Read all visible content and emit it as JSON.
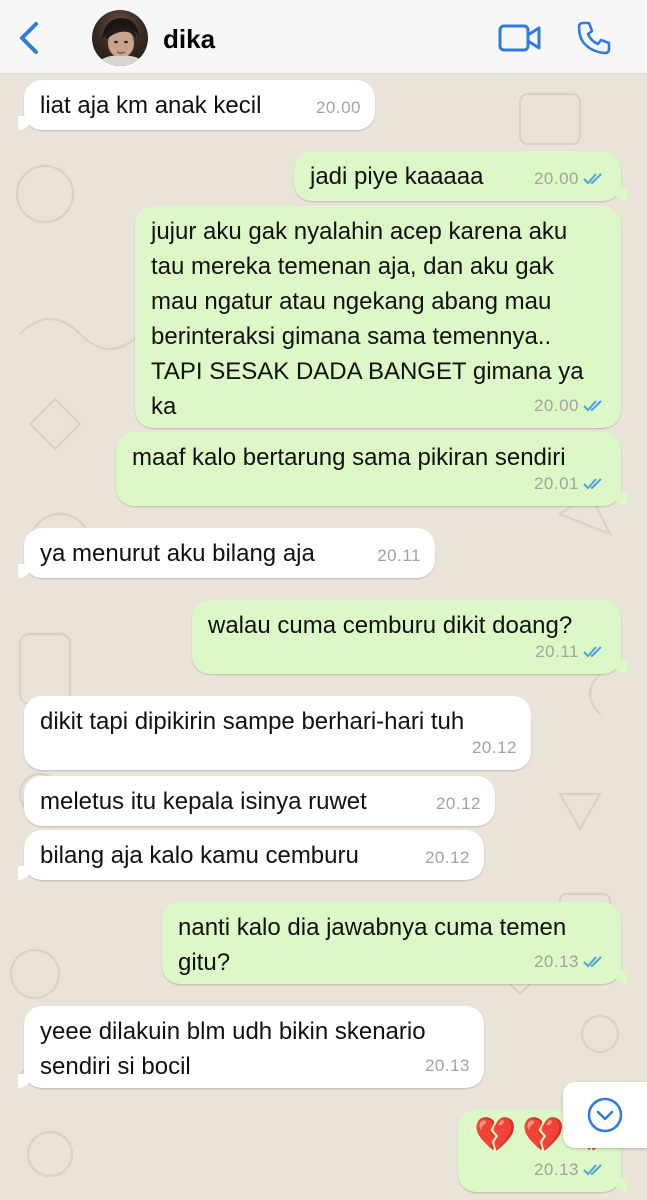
{
  "header": {
    "contact_name": "dika"
  },
  "messages": [
    {
      "dir": "in",
      "text": [
        "liat aja km anak kecil"
      ],
      "time": "20.00"
    },
    {
      "dir": "out",
      "text": [
        "jadi piye kaaaaa"
      ],
      "time": "20.00",
      "read": true
    },
    {
      "dir": "out",
      "text": [
        "jujur aku gak nyalahin acep karena aku",
        "tau mereka temenan aja, dan aku gak",
        "mau ngatur atau ngekang abang mau",
        "berinteraksi gimana sama temennya..",
        "TAPI SESAK DADA BANGET gimana ya",
        "ka"
      ],
      "time": "20.00",
      "read": true
    },
    {
      "dir": "out",
      "text": [
        "maaf kalo bertarung sama pikiran sendiri"
      ],
      "time": "20.01",
      "read": true
    },
    {
      "dir": "in",
      "text": [
        "ya menurut aku bilang aja"
      ],
      "time": "20.11"
    },
    {
      "dir": "out",
      "text": [
        "walau cuma cemburu dikit doang?"
      ],
      "time": "20.11",
      "read": true
    },
    {
      "dir": "in",
      "text": [
        "dikit tapi dipikirin sampe berhari-hari tuh"
      ],
      "time": "20.12"
    },
    {
      "dir": "in",
      "text": [
        "meletus itu kepala isinya ruwet"
      ],
      "time": "20.12"
    },
    {
      "dir": "in",
      "text": [
        "bilang aja kalo kamu cemburu"
      ],
      "time": "20.12"
    },
    {
      "dir": "out",
      "text": [
        "nanti kalo dia jawabnya cuma temen",
        "gitu?"
      ],
      "time": "20.13",
      "read": true
    },
    {
      "dir": "in",
      "text": [
        "yeee dilakuin blm udh bikin skenario",
        "sendiri si bocil"
      ],
      "time": "20.13"
    },
    {
      "dir": "out",
      "text": [
        "💔💔💔"
      ],
      "time": "20.13",
      "read": true,
      "emoji": true
    }
  ],
  "colors": {
    "accent": "#2f7be0",
    "incoming_bubble": "#ffffff",
    "outgoing_bubble": "#dcf8c6",
    "read_ticks": "#4fa3e0",
    "wallpaper": "#e9e3d9"
  },
  "icons": {
    "back": "chevron-left-icon",
    "video": "video-camera-icon",
    "call": "phone-icon",
    "scroll_down": "chevron-down-circle-icon"
  }
}
